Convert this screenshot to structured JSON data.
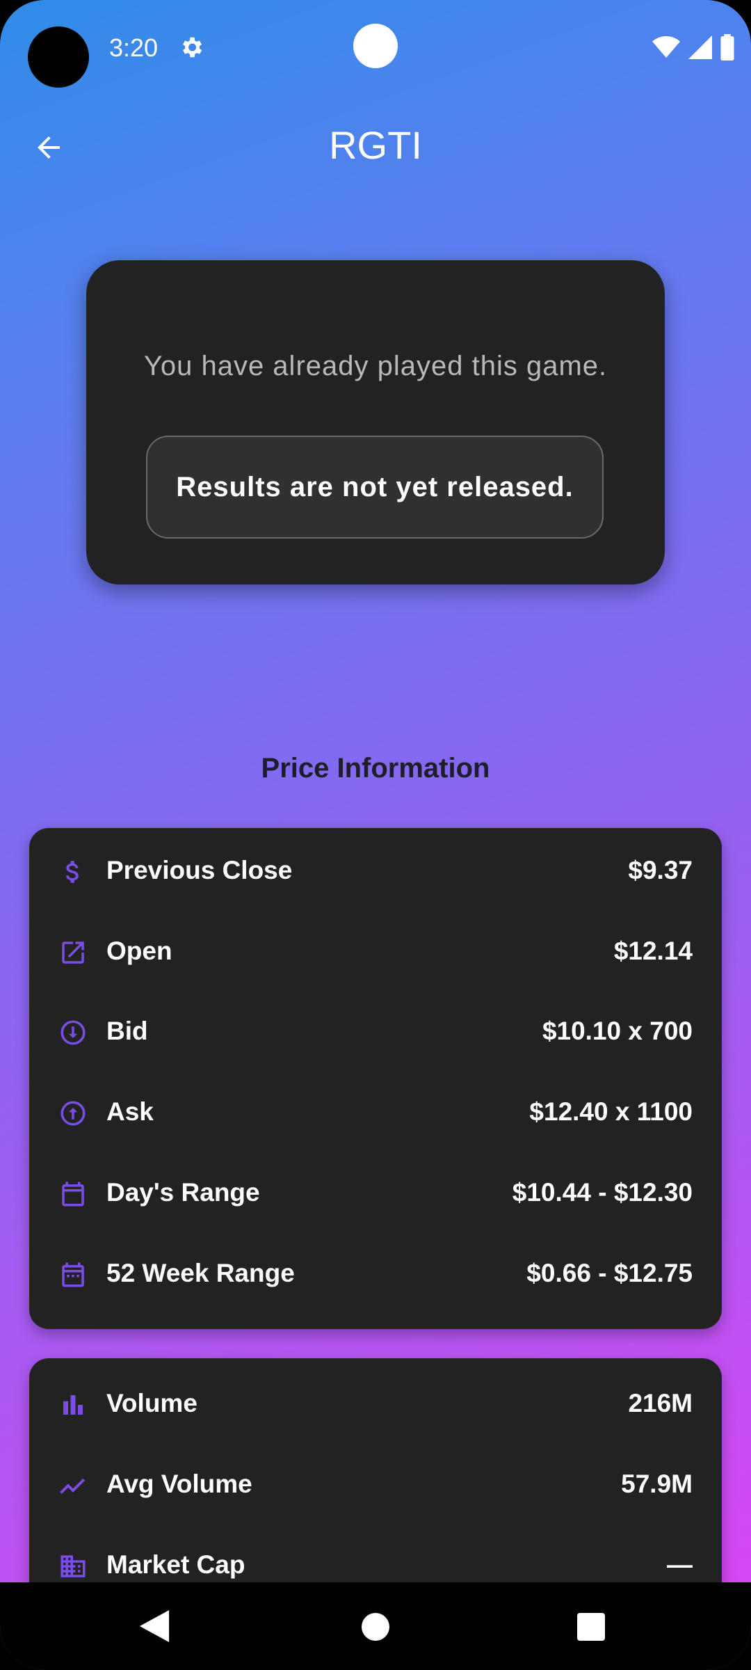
{
  "status_bar": {
    "time": "3:20",
    "icons": [
      "gear-icon",
      "wifi-icon",
      "signal-icon",
      "battery-icon"
    ]
  },
  "app_bar": {
    "title": "RGTI",
    "back_icon": "arrow-back-icon"
  },
  "game_card": {
    "message": "You have already played this game.",
    "results_label": "Results are not yet released."
  },
  "price_section": {
    "heading": "Price Information",
    "rows": [
      {
        "label": "Previous Close",
        "value": "$9.37",
        "icon": "dollar-icon"
      },
      {
        "label": "Open",
        "value": "$12.14",
        "icon": "open-in-new-icon"
      },
      {
        "label": "Bid",
        "value": "$10.10 x 700",
        "icon": "arrow-down-circle-icon"
      },
      {
        "label": "Ask",
        "value": "$12.40 x 1100",
        "icon": "arrow-up-circle-icon"
      },
      {
        "label": "Day's Range",
        "value": "$10.44 - $12.30",
        "icon": "calendar-icon"
      },
      {
        "label": "52 Week Range",
        "value": "$0.66 - $12.75",
        "icon": "calendar-month-icon"
      }
    ]
  },
  "volume_section": {
    "rows": [
      {
        "label": "Volume",
        "value": "216M",
        "icon": "bar-chart-icon"
      },
      {
        "label": "Avg Volume",
        "value": "57.9M",
        "icon": "trending-icon"
      },
      {
        "label": "Market Cap",
        "value": "—",
        "icon": "business-icon"
      }
    ]
  },
  "colors": {
    "accent": "#7b4de8",
    "card": "#222223",
    "gradient_top": "#2f8ce8",
    "gradient_bottom": "#df44f5"
  }
}
